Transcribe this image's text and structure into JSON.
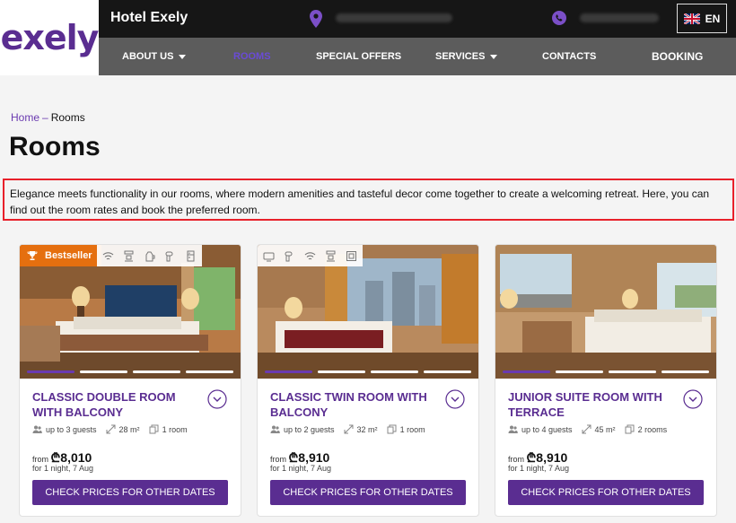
{
  "header": {
    "logo_text": "exely",
    "hotel_name": "Hotel Exely",
    "language": "EN"
  },
  "nav": {
    "items": [
      {
        "label": "ABOUT US",
        "has_dropdown": true,
        "active": false
      },
      {
        "label": "ROOMS",
        "has_dropdown": false,
        "active": true
      },
      {
        "label": "SPECIAL OFFERS",
        "has_dropdown": false,
        "active": false
      },
      {
        "label": "SERVICES",
        "has_dropdown": true,
        "active": false
      },
      {
        "label": "CONTACTS",
        "has_dropdown": false,
        "active": false
      }
    ],
    "booking_label": "BOOKING"
  },
  "breadcrumb": {
    "home": "Home",
    "separator": "–",
    "current": "Rooms"
  },
  "page": {
    "title": "Rooms",
    "intro": "Elegance meets functionality in our rooms, where modern amenities and tasteful decor come together to create a welcoming retreat. Here, you can find out the room rates and book the preferred room."
  },
  "colors": {
    "brand": "#5a2d91",
    "badge": "#e56f0f",
    "highlight_border": "#e8202a"
  },
  "rooms": [
    {
      "badge": "Bestseller",
      "amenities": [
        "wifi-icon",
        "coffee-machine-icon",
        "kettle-icon",
        "hairdryer-icon",
        "fridge-icon"
      ],
      "name": "CLASSIC DOUBLE ROOM WITH BALCONY",
      "guests": "up to 3 guests",
      "area": "28 m²",
      "rooms": "1 room",
      "from": "from",
      "price": "₾8,010",
      "price_note": "for 1 night, 7 Aug",
      "cta": "CHECK PRICES FOR OTHER DATES",
      "active_slide": 0
    },
    {
      "badge": "",
      "amenities": [
        "tv-icon",
        "hairdryer-icon",
        "wifi-icon",
        "coffee-machine-icon",
        "safe-icon"
      ],
      "name": "CLASSIC TWIN ROOM WITH BALCONY",
      "guests": "up to 2 guests",
      "area": "32 m²",
      "rooms": "1 room",
      "from": "from",
      "price": "₾8,910",
      "price_note": "for 1 night, 7 Aug",
      "cta": "CHECK PRICES FOR OTHER DATES",
      "active_slide": 0
    },
    {
      "badge": "",
      "amenities": [],
      "name": "JUNIOR SUITE ROOM WITH TERRACE",
      "guests": "up to 4 guests",
      "area": "45 m²",
      "rooms": "2 rooms",
      "from": "from",
      "price": "₾8,910",
      "price_note": "for 1 night, 7 Aug",
      "cta": "CHECK PRICES FOR OTHER DATES",
      "active_slide": 0
    }
  ]
}
